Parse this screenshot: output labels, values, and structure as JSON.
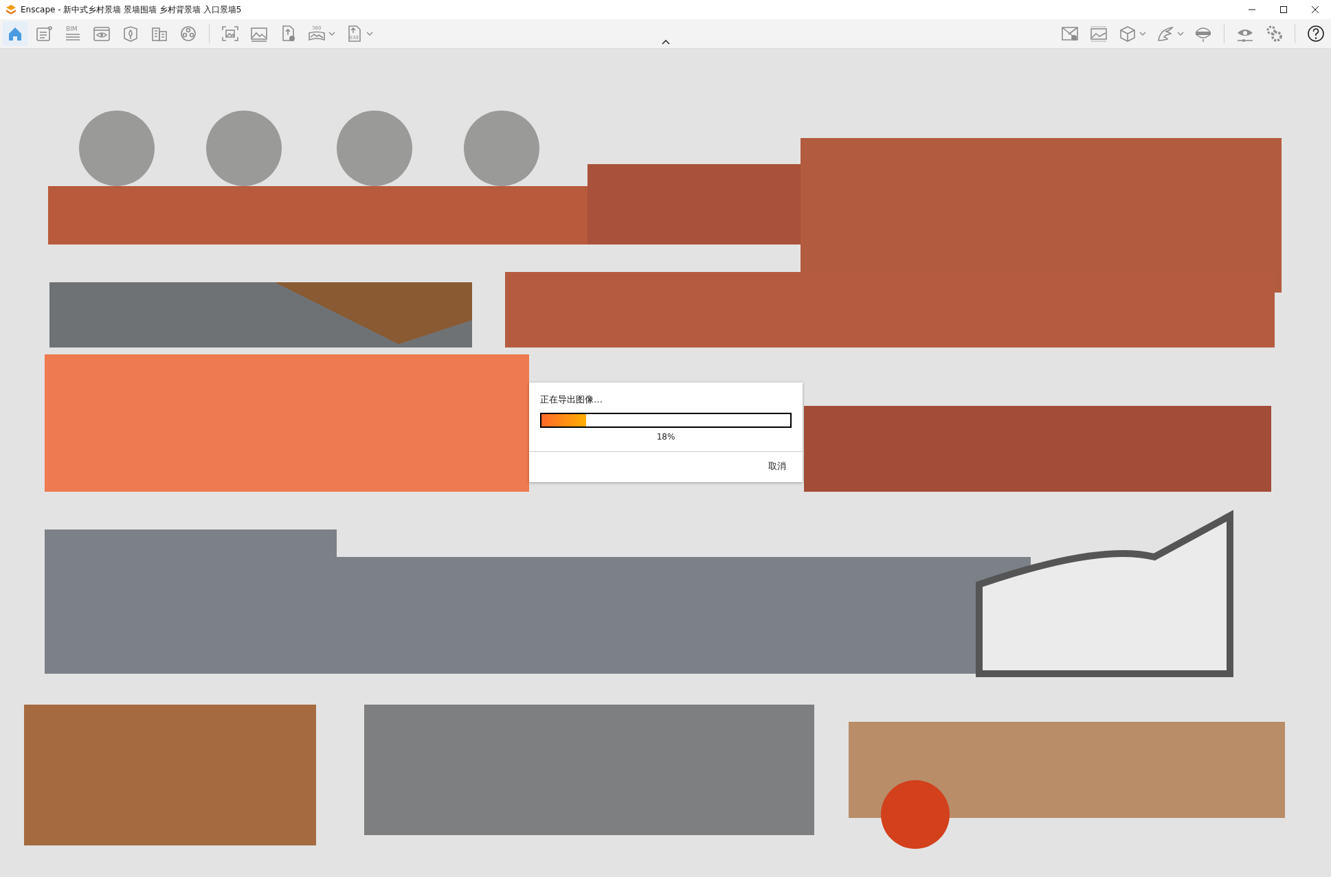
{
  "window": {
    "title": "Enscape - 新中式乡村景墙 景墙围墙 乡村背景墙 入口景墙5"
  },
  "toolbar": {
    "left_tools": [
      {
        "selected": true,
        "dropdown": false
      },
      {
        "selected": false,
        "dropdown": false
      },
      {
        "selected": false,
        "dropdown": false,
        "label": "BIM"
      },
      {
        "selected": false,
        "dropdown": false
      },
      {
        "selected": false,
        "dropdown": false
      },
      {
        "selected": false,
        "dropdown": false
      },
      {
        "selected": false,
        "dropdown": false
      },
      {
        "selected": false,
        "dropdown": false
      },
      {
        "selected": false,
        "dropdown": false
      },
      {
        "selected": false,
        "dropdown": false
      },
      {
        "selected": false,
        "dropdown": true,
        "label": "360"
      },
      {
        "selected": false,
        "dropdown": true,
        "label": "EXE"
      }
    ],
    "right_tools": [
      {
        "dropdown": false
      },
      {
        "dropdown": false
      },
      {
        "dropdown": true
      },
      {
        "dropdown": true
      },
      {
        "dropdown": false
      },
      {
        "dropdown": false
      },
      {
        "dropdown": false
      },
      {
        "dropdown": false
      }
    ]
  },
  "export_dialog": {
    "message": "正在导出图像…",
    "progress": {
      "level": 0.18,
      "reading": "18%"
    },
    "buttons": [
      "取消"
    ]
  }
}
